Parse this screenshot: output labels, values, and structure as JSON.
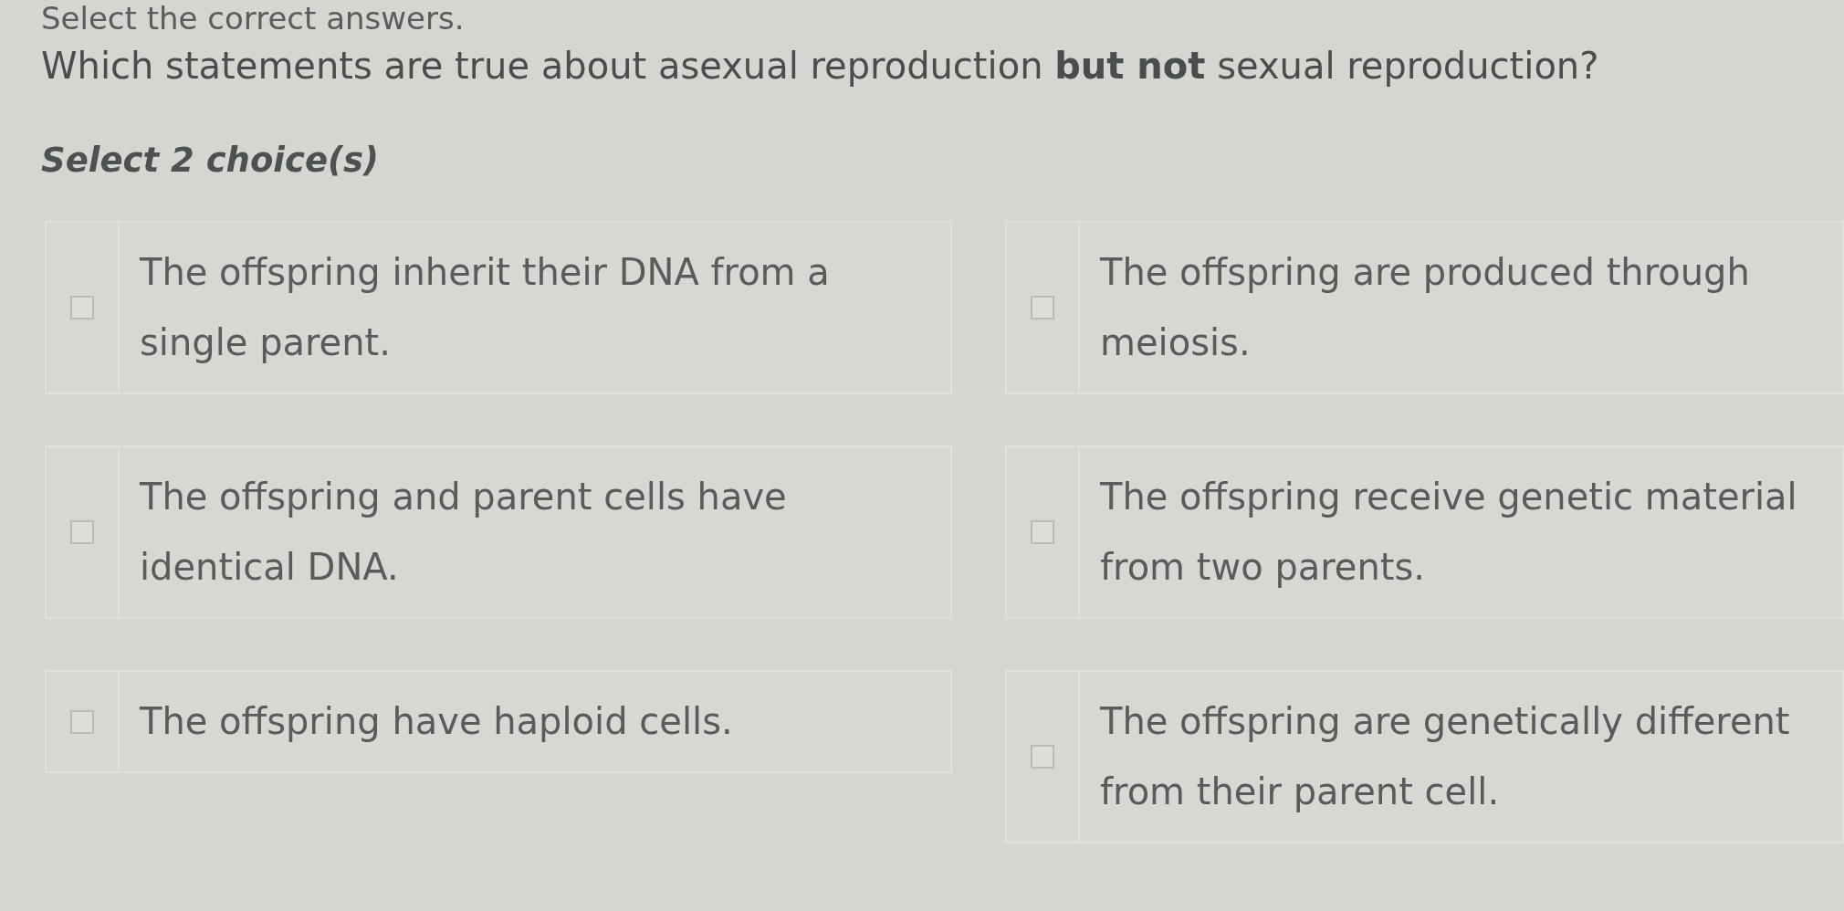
{
  "instruction": "Select the correct answers.",
  "question": "Which statements are true about asexual reproduction **but not** sexual reproduction?",
  "prompt": "Select 2 choice(s)",
  "choices": [
    {
      "text": "The offspring inherit their DNA from a single parent.",
      "checked": false
    },
    {
      "text": "The offspring are produced through meiosis.",
      "checked": false
    },
    {
      "text": "The offspring and parent cells have identical DNA.",
      "checked": false
    },
    {
      "text": "The offspring receive genetic material from two parents.",
      "checked": false
    },
    {
      "text": "The offspring have haploid cells.",
      "checked": false
    },
    {
      "text": "The offspring are genetically different from their parent cell.",
      "checked": false
    }
  ]
}
